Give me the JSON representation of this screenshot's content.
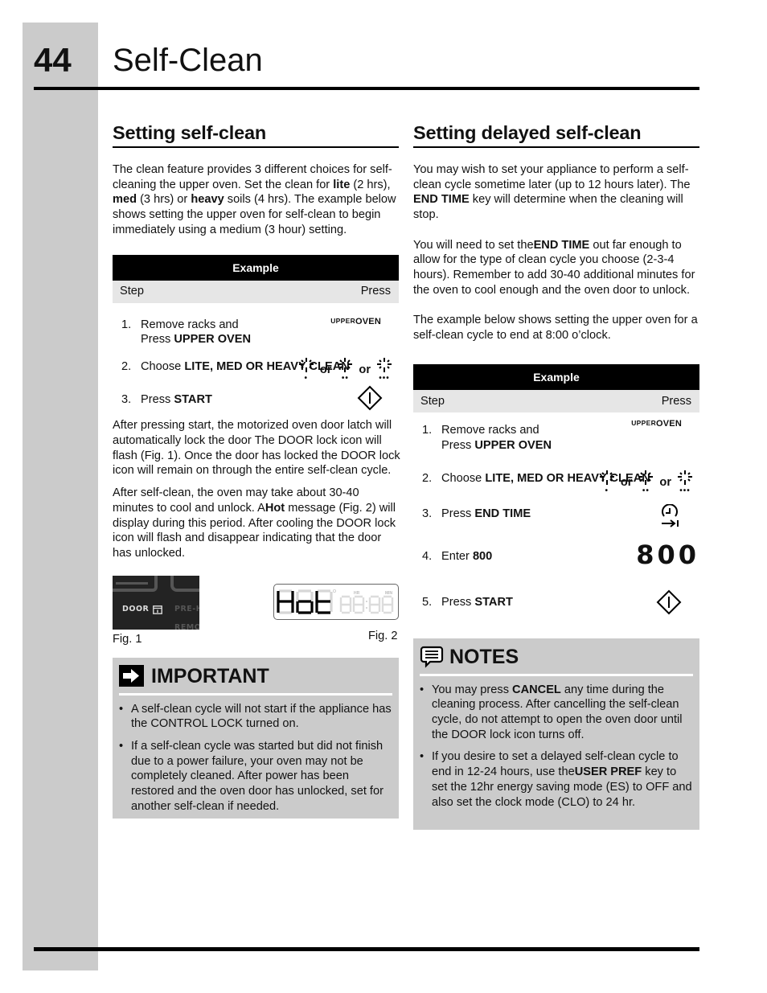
{
  "header": {
    "page_number": "44",
    "title": "Self-Clean"
  },
  "left": {
    "heading": "Setting self-clean",
    "intro": {
      "p1": "The clean feature provides 3 different choices for self-cleaning the upper oven. Set the clean for ",
      "b1": "lite",
      "p2": " (2 hrs), ",
      "b2": "med",
      "p3": " (3 hrs) or ",
      "b3": "heavy",
      "p4": " soils (4 hrs). The example below shows setting the upper oven for self-clean to begin immediately using a medium (3 hour) setting."
    },
    "example": {
      "header": "Example",
      "step_col": "Step",
      "press_col": "Press",
      "steps": [
        {
          "num": "1.",
          "line1": "Remove racks and",
          "pre": "Press ",
          "bold": "UPPER OVEN",
          "press_icon": "upper-oven-key"
        },
        {
          "num": "2.",
          "pre": "Choose ",
          "bold": "LITE, MED OR HEAVY CLEAN",
          "press_icon": "clean-level-keys"
        },
        {
          "num": "3.",
          "pre": "Press ",
          "bold": "START",
          "press_icon": "start-key"
        }
      ]
    },
    "para_after_start": "After pressing start, the motorized oven door latch will automatically lock the door The DOOR lock icon will flash (Fig. 1). Once the door has locked the DOOR lock icon will remain on through the entire self-clean cycle.",
    "para_cool": {
      "p1": "After self-clean, the oven may take about 30-40 minutes to cool and unlock.  A",
      "b1": "Hot",
      "p2": " message (Fig. 2) will display during this period. After cooling the DOOR lock icon will flash and disappear indicating that the door has unlocked."
    },
    "fig1": {
      "label": "Fig. 1",
      "door_text": "DOOR",
      "preheat_text": "PRE-H",
      "remote_text": "REMO"
    },
    "fig2": {
      "label": "Fig. 2",
      "display_text": "Hot",
      "hr_label": "HR",
      "min_label": "MIN"
    },
    "important": {
      "title": "IMPORTANT",
      "items": [
        "A self-clean cycle will not start if the appliance has the CONTROL LOCK turned on.",
        "If a self-clean cycle was started but did not finish due to a power failure, your oven may not be completely cleaned. After power has been restored and the oven door has unlocked, set for another self-clean if needed."
      ]
    }
  },
  "right": {
    "heading": "Setting delayed self-clean",
    "p1": {
      "a": "You may wish to set your appliance to perform a self-clean cycle sometime later (up to 12 hours later). The ",
      "b": "END TIME",
      "c": " key will determine when the cleaning will stop."
    },
    "p2": {
      "a": "You will need to set the",
      "b": "END TIME",
      "c": " out far enough to allow for the type of clean cycle you choose (2-3-4 hours). Remember to add 30-40 additional minutes for the oven to cool enough and the oven door to unlock."
    },
    "p3": "The example below shows setting the upper oven for a self-clean cycle to end at 8:00 o’clock.",
    "example": {
      "header": "Example",
      "step_col": "Step",
      "press_col": "Press",
      "steps": [
        {
          "num": "1.",
          "line1": "Remove racks and",
          "pre": "Press ",
          "bold": "UPPER OVEN",
          "press_icon": "upper-oven-key"
        },
        {
          "num": "2.",
          "pre": "Choose ",
          "bold": "LITE, MED OR HEAVY CLEAN",
          "press_icon": "clean-level-keys"
        },
        {
          "num": "3.",
          "pre": "Press ",
          "bold": "END TIME",
          "press_icon": "end-time-key"
        },
        {
          "num": "4.",
          "pre": "Enter ",
          "bold": "800",
          "press_value": "800"
        },
        {
          "num": "5.",
          "pre": "Press ",
          "bold": "START",
          "press_icon": "start-key"
        }
      ]
    },
    "notes": {
      "title": "NOTES",
      "item1": {
        "a": "You may press ",
        "b": "CANCEL",
        "c": " any time during the cleaning process. After cancelling the self-clean cycle, do not attempt to open the oven door until the DOOR lock icon turns off."
      },
      "item2": {
        "a": "If you desire to set a  delayed self-clean cycle to end in 12-24 hours, use the",
        "b": "USER PREF",
        "c": " key to set the 12hr energy saving mode (ES) to OFF and also set the clock mode (CLO) to 24 hr."
      }
    }
  },
  "keys": {
    "upper_small": "UPPER",
    "oven_big": "OVEN",
    "or": "or"
  }
}
